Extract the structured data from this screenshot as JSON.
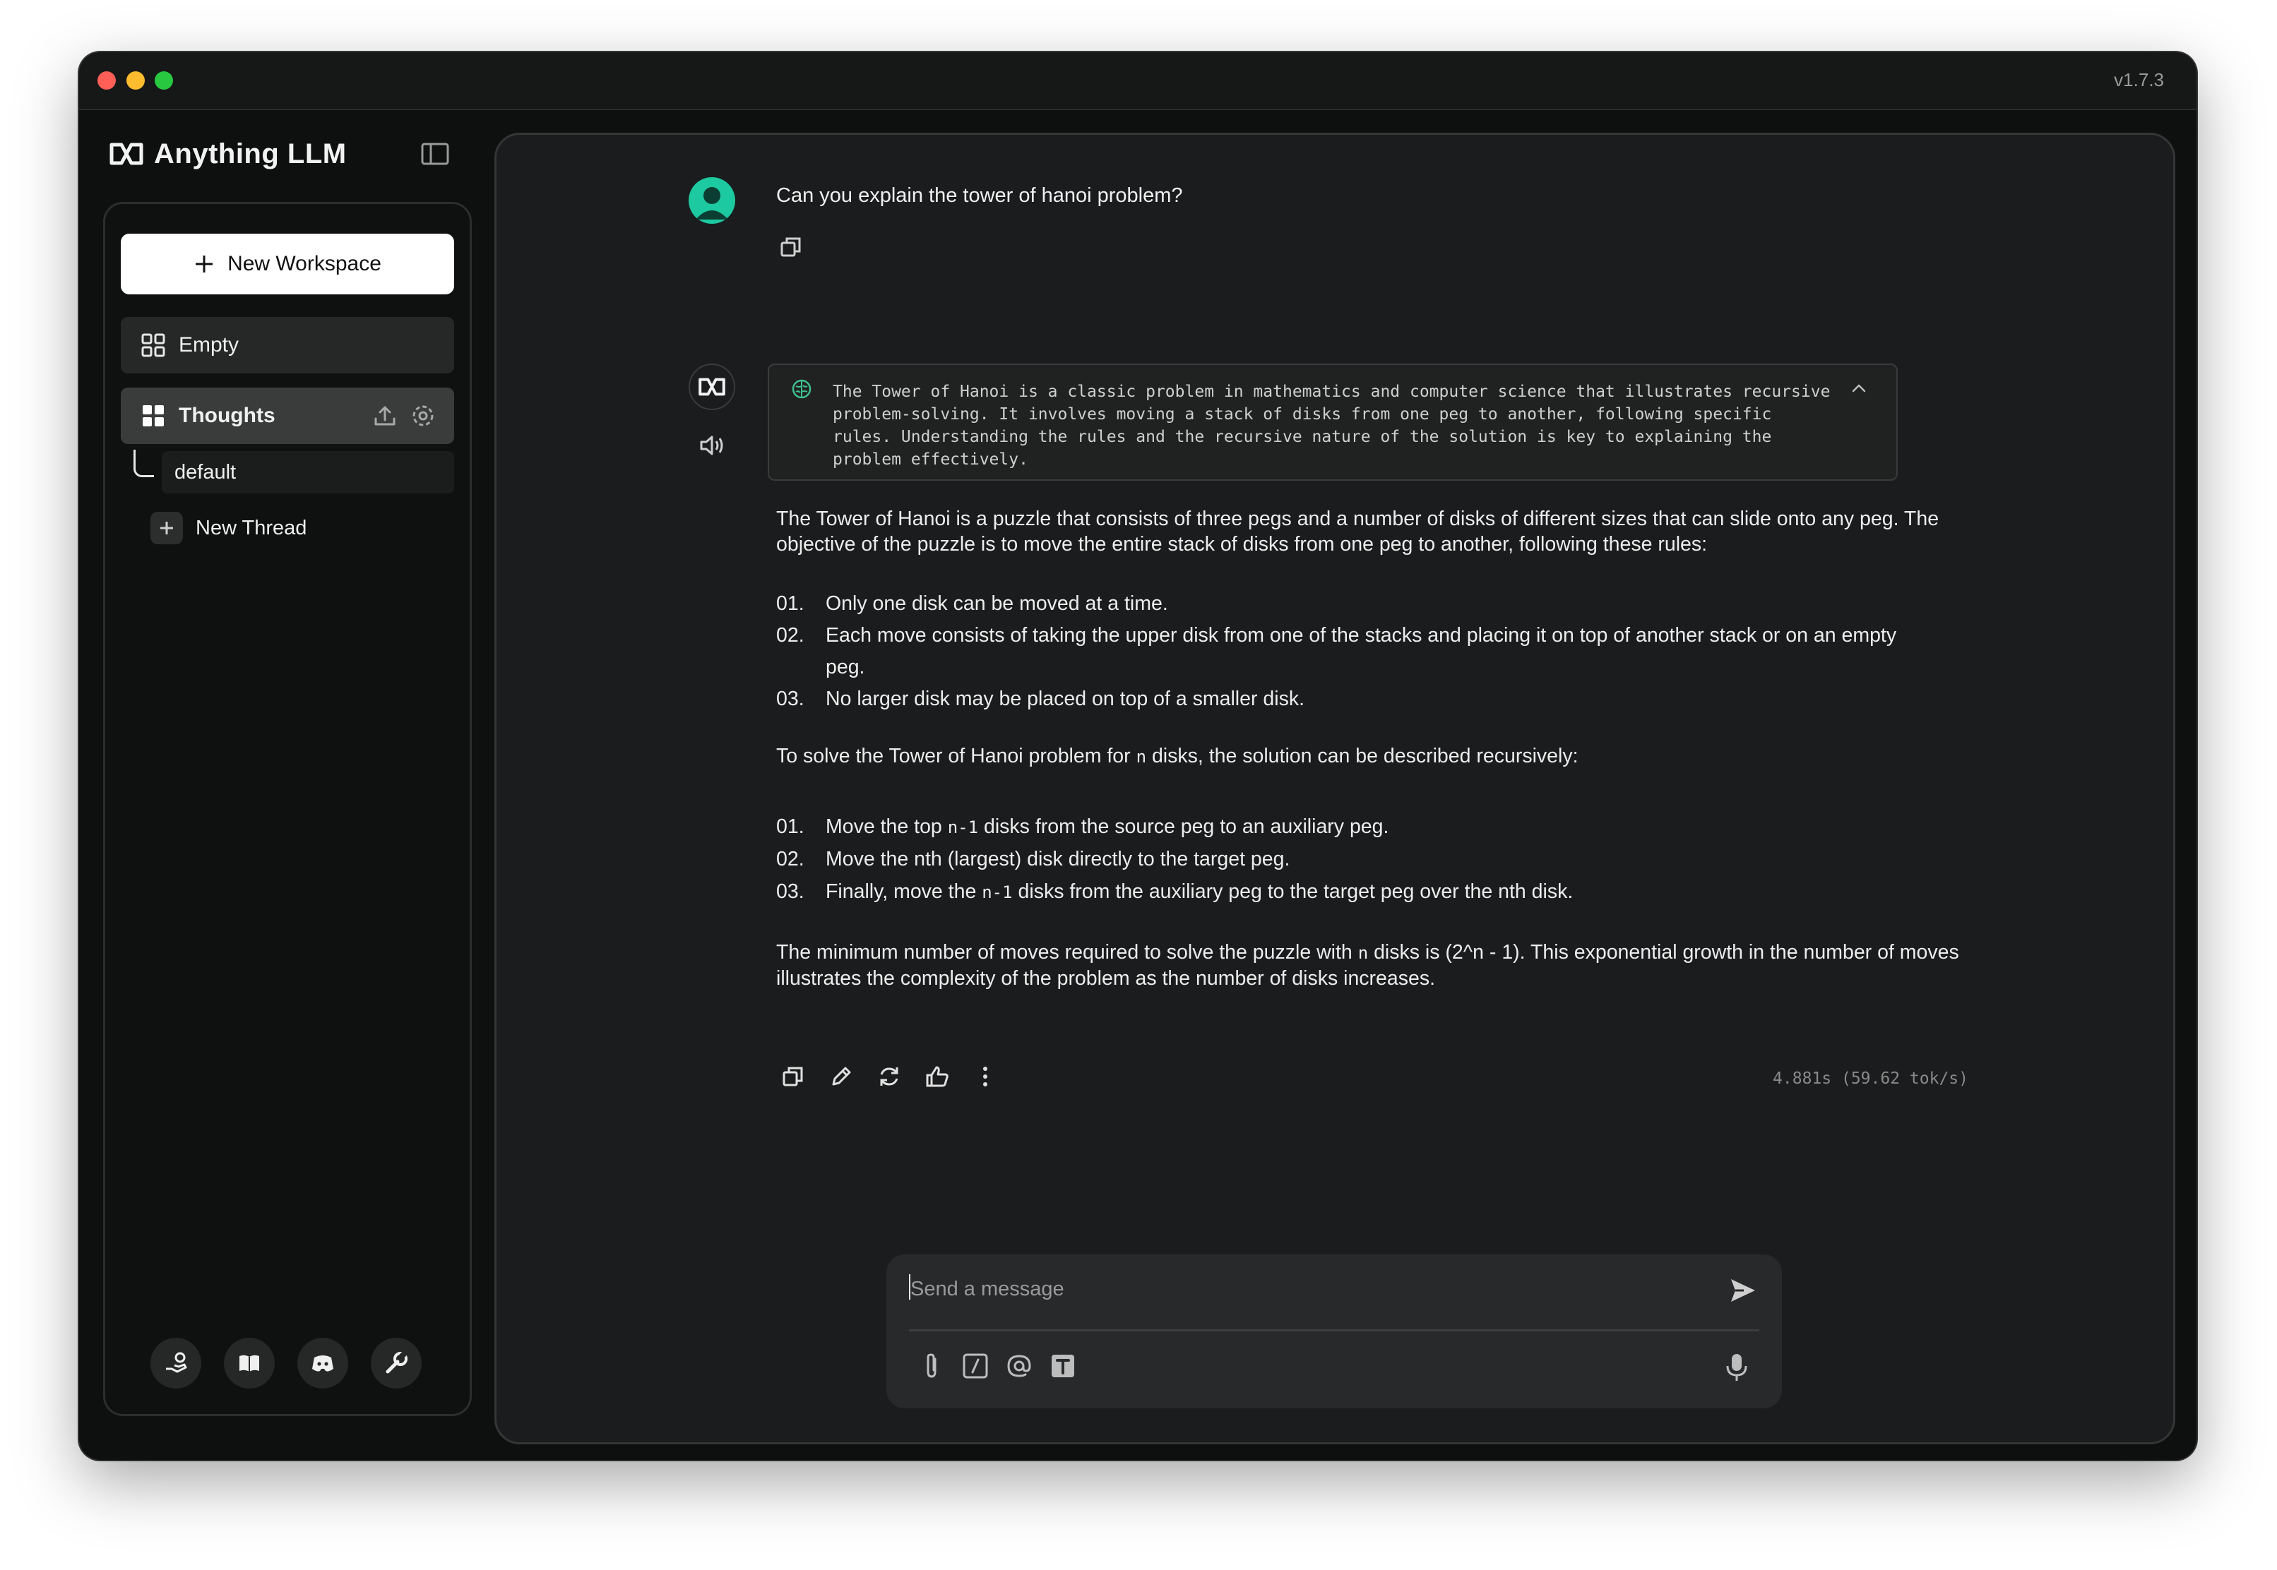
{
  "window": {
    "version": "v1.7.3"
  },
  "sidebar": {
    "brand": "Anything LLM",
    "new_workspace_label": "New Workspace",
    "workspaces": [
      {
        "label": "Empty",
        "icon": "grid-icon"
      },
      {
        "label": "Thoughts",
        "icon": "grid-filled-icon",
        "active": true
      }
    ],
    "threads": [
      {
        "label": "default"
      }
    ],
    "new_thread_label": "New Thread",
    "footer_icons": [
      "community-hand-icon",
      "docs-book-icon",
      "discord-icon",
      "settings-wrench-icon"
    ]
  },
  "chat": {
    "user_message": "Can you explain the tower of hanoi problem?",
    "thought_text": "The Tower of Hanoi is a classic problem in mathematics and computer science that illustrates recursive problem-solving. It involves moving a stack of disks from one peg to another, following specific rules. Understanding the rules and the recursive nature of the solution is key to explaining the problem effectively.",
    "answer": {
      "para1": "The Tower of Hanoi is a puzzle that consists of three pegs and a number of disks of different sizes that can slide onto any peg. The objective of the puzzle is to move the entire stack of disks from one peg to another, following these rules:",
      "rules": [
        {
          "num": "01.",
          "text": "Only one disk can be moved at a time."
        },
        {
          "num": "02.",
          "text": "Each move consists of taking the upper disk from one of the stacks and placing it on top of another stack or on an empty peg."
        },
        {
          "num": "03.",
          "text": "No larger disk may be placed on top of a smaller disk."
        }
      ],
      "para2_pre": "To solve the Tower of Hanoi problem for ",
      "para2_code": "n",
      "para2_post": " disks, the solution can be described recursively:",
      "steps": [
        {
          "num": "01.",
          "pre": "Move the top ",
          "code": "n-1",
          "post": " disks from the source peg to an auxiliary peg."
        },
        {
          "num": "02.",
          "pre": "Move the nth (largest) disk directly to the target peg.",
          "code": "",
          "post": ""
        },
        {
          "num": "03.",
          "pre": "Finally, move the ",
          "code": "n-1",
          "post": " disks from the auxiliary peg to the target peg over the nth disk."
        }
      ],
      "para3_pre": "The minimum number of moves required to solve the puzzle with ",
      "para3_code": "n",
      "para3_post": " disks is (2^n - 1). This exponential growth in the number of moves illustrates the complexity of the problem as the number of disks increases."
    },
    "metrics": "4.881s (59.62 tok/s)",
    "message_actions": [
      "copy-icon",
      "edit-icon",
      "regenerate-icon",
      "thumbs-up-icon",
      "more-options-icon"
    ]
  },
  "composer": {
    "placeholder": "Send a message",
    "value": "",
    "tools": [
      "attach-icon",
      "slash-command-icon",
      "at-mention-icon",
      "text-format-icon"
    ]
  },
  "colors": {
    "accent": "#1cc9a0",
    "background": "#0e0f0f",
    "panel": "#1b1c1d"
  }
}
